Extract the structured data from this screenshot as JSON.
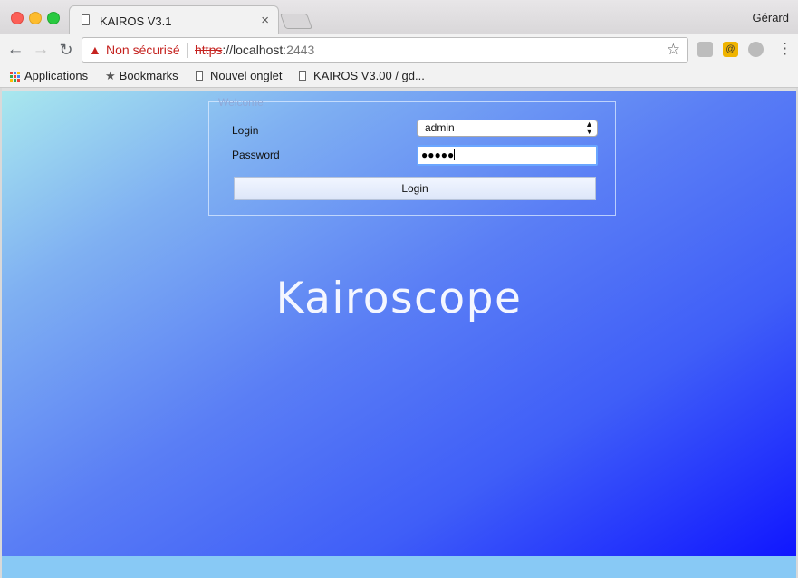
{
  "browser": {
    "tab_title": "KAIROS V3.1",
    "tab_close": "×",
    "profile_name": "Gérard",
    "security_text": "Non sécurisé",
    "url_scheme": "https",
    "url_separator": "://",
    "url_host": "localhost",
    "url_port": ":2443",
    "bookmarks": [
      "Applications",
      "Bookmarks",
      "Nouvel onglet",
      "KAIROS V3.00 / gd..."
    ]
  },
  "login_form": {
    "legend": "Welcome",
    "login_label": "Login",
    "login_value": "admin",
    "password_label": "Password",
    "password_mask": "●●●●●",
    "submit_label": "Login"
  },
  "brand": {
    "name": "Kairoscope"
  },
  "colors": {
    "warning": "#c5221f",
    "gradient_start": "#a9e8ee",
    "gradient_end": "#1016ff",
    "status_bar": "#88c9f5"
  },
  "icons": [
    "page-icon",
    "close-icon",
    "back-icon",
    "forward-icon",
    "reload-icon",
    "warning-icon",
    "star-icon",
    "drive-icon",
    "lock-extension-icon",
    "compass-icon",
    "menu-icon",
    "apps-icon",
    "bookmark-star-icon"
  ]
}
